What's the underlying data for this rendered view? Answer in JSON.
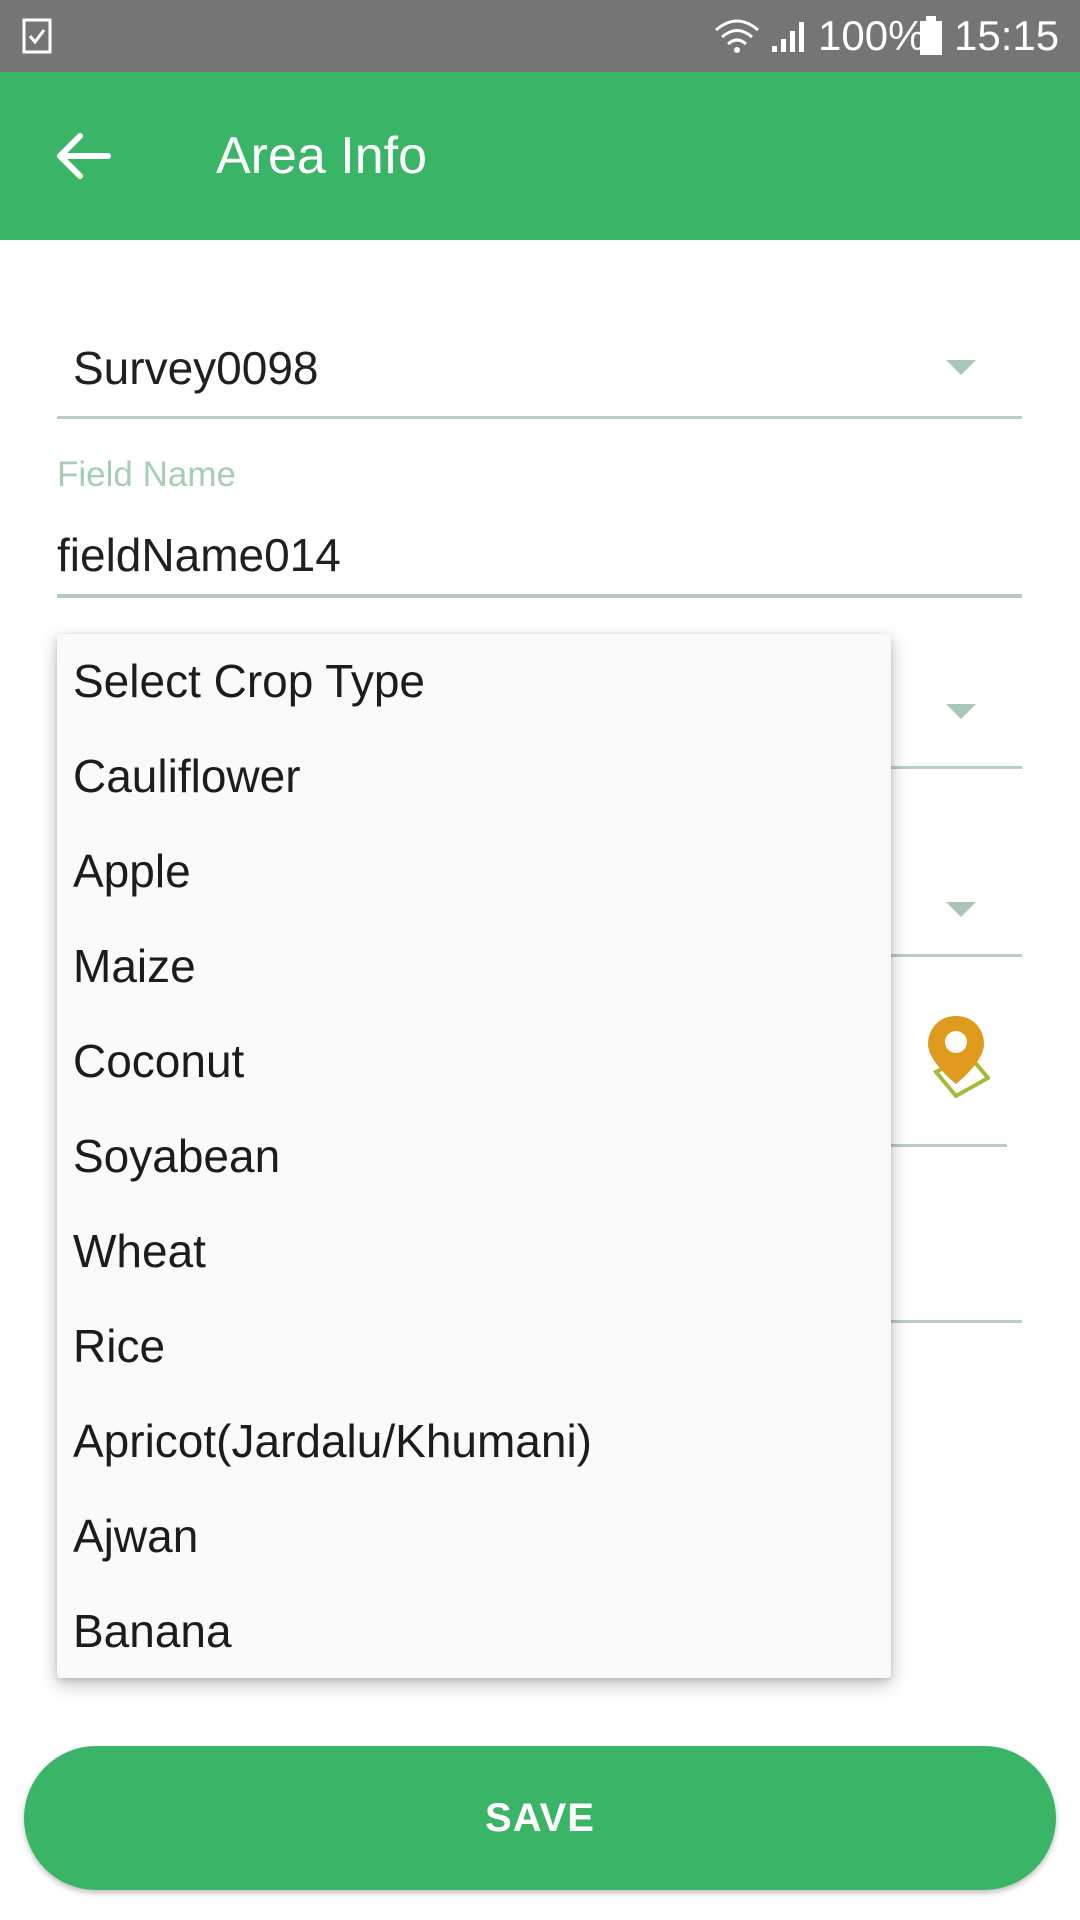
{
  "status_bar": {
    "battery_percent": "100%",
    "time": "15:15"
  },
  "app_bar": {
    "title": "Area Info",
    "back_icon": "arrow-left-icon"
  },
  "form": {
    "survey": {
      "value": "Survey0098"
    },
    "field_name": {
      "label": "Field Name",
      "value": "fieldName014"
    }
  },
  "crop_dropdown": {
    "items": [
      "Select Crop Type",
      "Cauliflower",
      "Apple",
      "Maize",
      "Coconut",
      "Soyabean",
      "Wheat",
      "Rice",
      "Apricot(Jardalu/Khumani)",
      "Ajwan",
      "Banana"
    ]
  },
  "save_button": {
    "label": "SAVE"
  },
  "colors": {
    "primary": "#3ab567",
    "status_bar": "#757575",
    "underline": "#b8cfc2",
    "label": "#a5cfb5",
    "marker": "#e09a1e"
  }
}
